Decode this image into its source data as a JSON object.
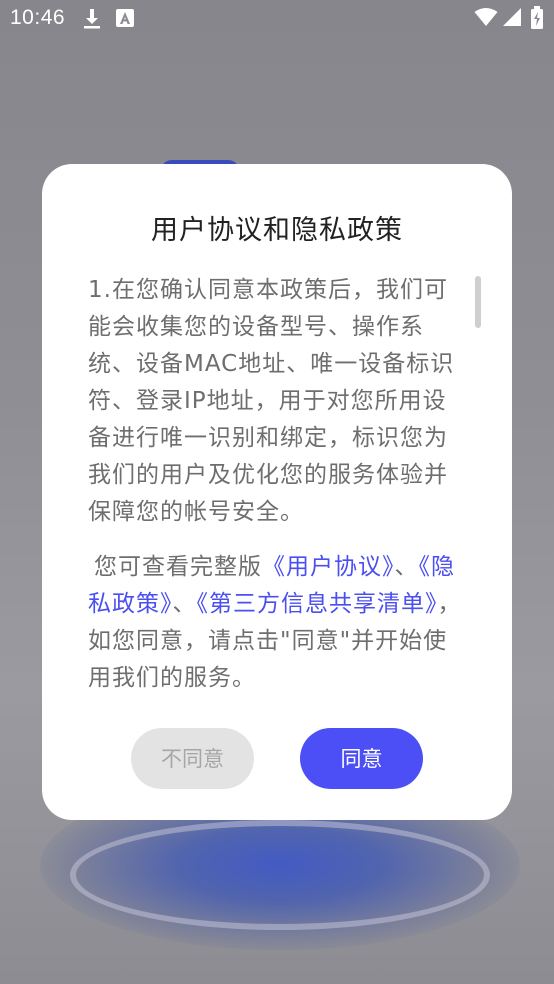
{
  "status_bar": {
    "time": "10:46",
    "icons": [
      "download-icon",
      "a-badge-icon",
      "wifi-icon",
      "signal-icon",
      "battery-icon"
    ]
  },
  "dialog": {
    "title": "用户协议和隐私政策",
    "paragraph1": "1.在您确认同意本政策后，我们可能会收集您的设备型号、操作系统、设备MAC地址、唯一设备标识符、登录IP地址，用于对您所用设备进行唯一识别和绑定，标识您为我们的用户及优化您的服务体验并保障您的帐号安全。",
    "paragraph2": {
      "prefix": "您可查看完整版",
      "link_user_agreement": "《用户协议》",
      "sep1": "、",
      "link_privacy_policy": "《隐私政策》",
      "sep2": "、",
      "link_third_party": "《第三方信息共享清单》",
      "suffix": "，如您同意，请点击\"同意\"并开始使用我们的服务。"
    },
    "buttons": {
      "disagree": "不同意",
      "agree": "同意"
    }
  },
  "colors": {
    "accent": "#4b4ff5",
    "link": "#4b4ff0",
    "body_text": "#6e6e6e",
    "title_text": "#222222"
  }
}
